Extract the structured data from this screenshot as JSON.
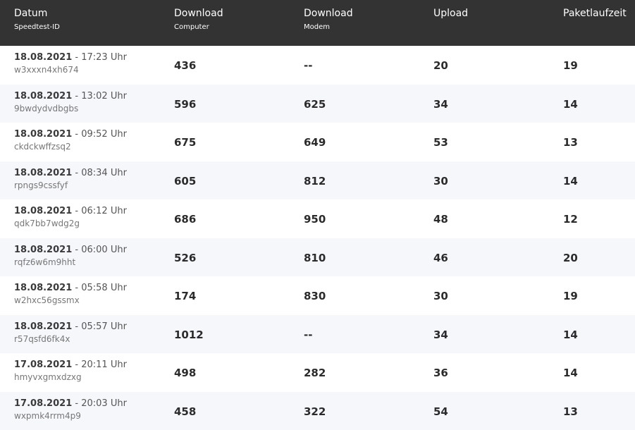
{
  "header": {
    "col0_main": "Datum",
    "col0_sub": "Speedtest-ID",
    "col1_main": "Download",
    "col1_sub": "Computer",
    "col2_main": "Download",
    "col2_sub": "Modem",
    "col3_main": "Upload",
    "col4_main": "Paketlaufzeit"
  },
  "time_sep": " - ",
  "rows": [
    {
      "date": "18.08.2021",
      "time": "17:23 Uhr",
      "id": "w3xxxn4xh674",
      "dl_computer": "436",
      "dl_modem": "--",
      "upload": "20",
      "latency": "19"
    },
    {
      "date": "18.08.2021",
      "time": "13:02 Uhr",
      "id": "9bwdydvdbgbs",
      "dl_computer": "596",
      "dl_modem": "625",
      "upload": "34",
      "latency": "14"
    },
    {
      "date": "18.08.2021",
      "time": "09:52 Uhr",
      "id": "ckdckwffzsq2",
      "dl_computer": "675",
      "dl_modem": "649",
      "upload": "53",
      "latency": "13"
    },
    {
      "date": "18.08.2021",
      "time": "08:34 Uhr",
      "id": "rpngs9cssfyf",
      "dl_computer": "605",
      "dl_modem": "812",
      "upload": "30",
      "latency": "14"
    },
    {
      "date": "18.08.2021",
      "time": "06:12 Uhr",
      "id": "qdk7bb7wdg2g",
      "dl_computer": "686",
      "dl_modem": "950",
      "upload": "48",
      "latency": "12"
    },
    {
      "date": "18.08.2021",
      "time": "06:00 Uhr",
      "id": "rqfz6w6m9hht",
      "dl_computer": "526",
      "dl_modem": "810",
      "upload": "46",
      "latency": "20"
    },
    {
      "date": "18.08.2021",
      "time": "05:58 Uhr",
      "id": "w2hxc56gssmx",
      "dl_computer": "174",
      "dl_modem": "830",
      "upload": "30",
      "latency": "19"
    },
    {
      "date": "18.08.2021",
      "time": "05:57 Uhr",
      "id": "r57qsfd6fk4x",
      "dl_computer": "1012",
      "dl_modem": "--",
      "upload": "34",
      "latency": "14"
    },
    {
      "date": "17.08.2021",
      "time": "20:11 Uhr",
      "id": "hmyvxgmxdzxg",
      "dl_computer": "498",
      "dl_modem": "282",
      "upload": "36",
      "latency": "14"
    },
    {
      "date": "17.08.2021",
      "time": "20:03 Uhr",
      "id": "wxpmk4rrm4p9",
      "dl_computer": "458",
      "dl_modem": "322",
      "upload": "54",
      "latency": "13"
    }
  ],
  "colors": {
    "header_bg": "#333333",
    "row_alt_bg": "#f5f7fb",
    "row_bg": "#ffffff"
  }
}
